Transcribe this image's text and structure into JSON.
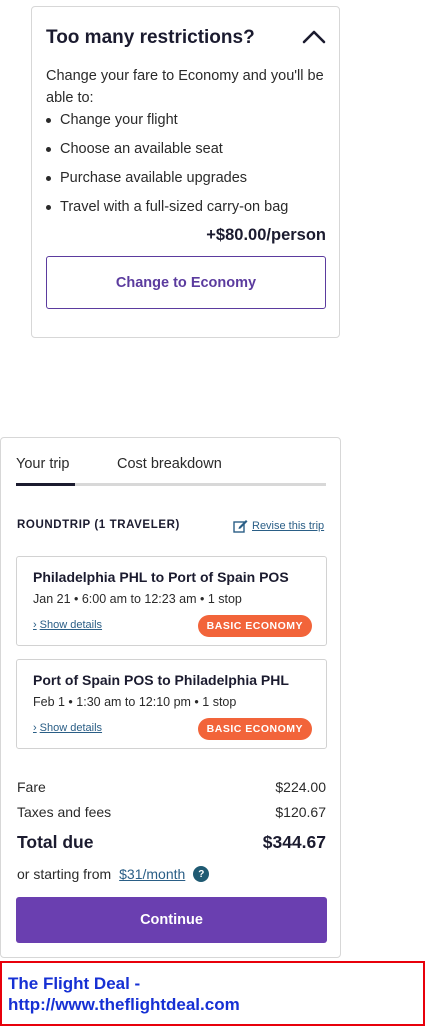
{
  "restrictions": {
    "title": "Too many restrictions?",
    "intro": "Change your fare to Economy and you'll be able to:",
    "benefits": [
      "Change your flight",
      "Choose an available seat",
      "Purchase available upgrades",
      "Travel with a full-sized carry-on bag"
    ],
    "price": "+$80.00/person",
    "button_label": "Change to Economy"
  },
  "trip": {
    "tabs": [
      "Your trip",
      "Cost breakdown"
    ],
    "roundtrip_label": "ROUNDTRIP (1 TRAVELER)",
    "revise_label": "Revise this trip",
    "flights": [
      {
        "route": "Philadelphia PHL to Port of Spain POS",
        "times": "Jan 21 • 6:00 am to 12:23 am • 1 stop",
        "details_label": "Show details",
        "badge": "BASIC ECONOMY"
      },
      {
        "route": "Port of Spain POS to Philadelphia PHL",
        "times": "Feb 1 • 1:30 am to 12:10 pm • 1 stop",
        "details_label": "Show details",
        "badge": "BASIC ECONOMY"
      }
    ],
    "costs": {
      "fare_label": "Fare",
      "fare_value": "$224.00",
      "taxes_label": "Taxes and fees",
      "taxes_value": "$120.67",
      "total_label": "Total due",
      "total_value": "$344.67"
    },
    "starting_prefix": "or starting from",
    "monthly_link": "$31/month",
    "help_glyph": "?",
    "continue_label": "Continue"
  },
  "watermark": {
    "line1": "The Flight Deal -",
    "line2": "http://www.theflightdeal.com"
  },
  "colors": {
    "accent_purple": "#6a3fb0",
    "badge_orange": "#f2643a",
    "link_blue": "#2a5e86",
    "watermark_red": "#e8000b",
    "watermark_text": "#1630d4"
  },
  "icons": {
    "collapse": "chevron-up-icon",
    "revise": "edit-icon",
    "details": "chevron-right-icon",
    "help": "help-icon"
  }
}
